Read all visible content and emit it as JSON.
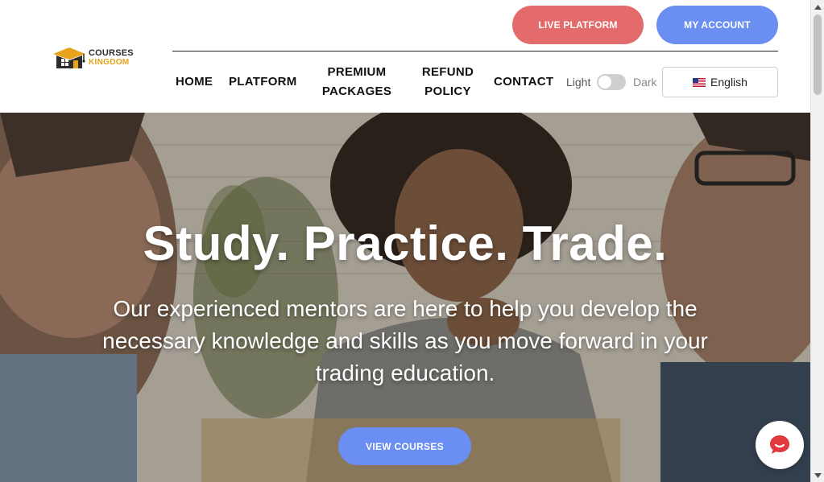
{
  "brand": {
    "line1": "COURSES",
    "line2": "KINGDOM",
    "logo_icon": "graduation-house-icon",
    "accent_color": "#e8a21b"
  },
  "header": {
    "live_platform_label": "LIVE PLATFORM",
    "my_account_label": "MY ACCOUNT",
    "live_color": "#e46b6b",
    "account_color": "#6a8ef2"
  },
  "nav": {
    "home": "HOME",
    "platform": "PLATFORM",
    "premium_line1": "PREMIUM",
    "premium_line2": "PACKAGES",
    "refund_line1": "REFUND",
    "refund_line2": "POLICY",
    "contact": "CONTACT"
  },
  "theme": {
    "light_label": "Light",
    "dark_label": "Dark",
    "dark_enabled": false
  },
  "language": {
    "selected": "English",
    "flag_icon": "us-flag-icon"
  },
  "hero": {
    "title": "Study. Practice. Trade.",
    "subtitle": "Our experienced mentors are here to help you develop the necessary knowledge and skills as you move forward in your trading education.",
    "cta_label": "VIEW COURSES",
    "cta_color": "#6a8ef2"
  },
  "chat": {
    "icon": "chat-bubble-icon",
    "color": "#e0393e"
  }
}
